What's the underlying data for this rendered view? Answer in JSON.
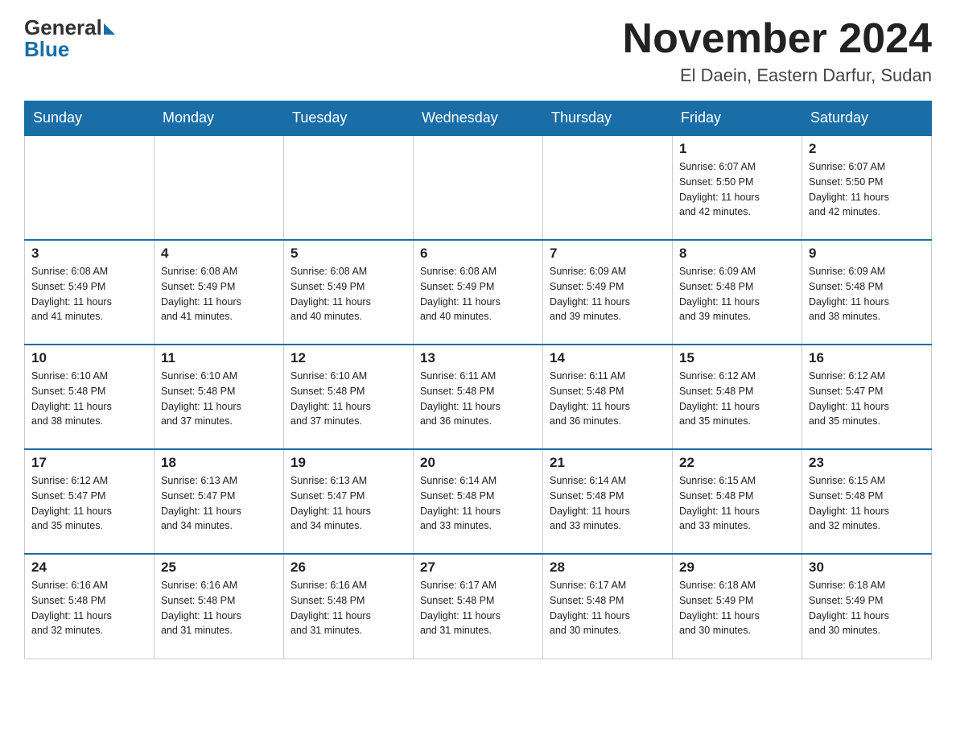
{
  "logo": {
    "general": "General",
    "blue": "Blue"
  },
  "title": "November 2024",
  "subtitle": "El Daein, Eastern Darfur, Sudan",
  "weekdays": [
    "Sunday",
    "Monday",
    "Tuesday",
    "Wednesday",
    "Thursday",
    "Friday",
    "Saturday"
  ],
  "weeks": [
    [
      {
        "day": "",
        "info": ""
      },
      {
        "day": "",
        "info": ""
      },
      {
        "day": "",
        "info": ""
      },
      {
        "day": "",
        "info": ""
      },
      {
        "day": "",
        "info": ""
      },
      {
        "day": "1",
        "info": "Sunrise: 6:07 AM\nSunset: 5:50 PM\nDaylight: 11 hours\nand 42 minutes."
      },
      {
        "day": "2",
        "info": "Sunrise: 6:07 AM\nSunset: 5:50 PM\nDaylight: 11 hours\nand 42 minutes."
      }
    ],
    [
      {
        "day": "3",
        "info": "Sunrise: 6:08 AM\nSunset: 5:49 PM\nDaylight: 11 hours\nand 41 minutes."
      },
      {
        "day": "4",
        "info": "Sunrise: 6:08 AM\nSunset: 5:49 PM\nDaylight: 11 hours\nand 41 minutes."
      },
      {
        "day": "5",
        "info": "Sunrise: 6:08 AM\nSunset: 5:49 PM\nDaylight: 11 hours\nand 40 minutes."
      },
      {
        "day": "6",
        "info": "Sunrise: 6:08 AM\nSunset: 5:49 PM\nDaylight: 11 hours\nand 40 minutes."
      },
      {
        "day": "7",
        "info": "Sunrise: 6:09 AM\nSunset: 5:49 PM\nDaylight: 11 hours\nand 39 minutes."
      },
      {
        "day": "8",
        "info": "Sunrise: 6:09 AM\nSunset: 5:48 PM\nDaylight: 11 hours\nand 39 minutes."
      },
      {
        "day": "9",
        "info": "Sunrise: 6:09 AM\nSunset: 5:48 PM\nDaylight: 11 hours\nand 38 minutes."
      }
    ],
    [
      {
        "day": "10",
        "info": "Sunrise: 6:10 AM\nSunset: 5:48 PM\nDaylight: 11 hours\nand 38 minutes."
      },
      {
        "day": "11",
        "info": "Sunrise: 6:10 AM\nSunset: 5:48 PM\nDaylight: 11 hours\nand 37 minutes."
      },
      {
        "day": "12",
        "info": "Sunrise: 6:10 AM\nSunset: 5:48 PM\nDaylight: 11 hours\nand 37 minutes."
      },
      {
        "day": "13",
        "info": "Sunrise: 6:11 AM\nSunset: 5:48 PM\nDaylight: 11 hours\nand 36 minutes."
      },
      {
        "day": "14",
        "info": "Sunrise: 6:11 AM\nSunset: 5:48 PM\nDaylight: 11 hours\nand 36 minutes."
      },
      {
        "day": "15",
        "info": "Sunrise: 6:12 AM\nSunset: 5:48 PM\nDaylight: 11 hours\nand 35 minutes."
      },
      {
        "day": "16",
        "info": "Sunrise: 6:12 AM\nSunset: 5:47 PM\nDaylight: 11 hours\nand 35 minutes."
      }
    ],
    [
      {
        "day": "17",
        "info": "Sunrise: 6:12 AM\nSunset: 5:47 PM\nDaylight: 11 hours\nand 35 minutes."
      },
      {
        "day": "18",
        "info": "Sunrise: 6:13 AM\nSunset: 5:47 PM\nDaylight: 11 hours\nand 34 minutes."
      },
      {
        "day": "19",
        "info": "Sunrise: 6:13 AM\nSunset: 5:47 PM\nDaylight: 11 hours\nand 34 minutes."
      },
      {
        "day": "20",
        "info": "Sunrise: 6:14 AM\nSunset: 5:48 PM\nDaylight: 11 hours\nand 33 minutes."
      },
      {
        "day": "21",
        "info": "Sunrise: 6:14 AM\nSunset: 5:48 PM\nDaylight: 11 hours\nand 33 minutes."
      },
      {
        "day": "22",
        "info": "Sunrise: 6:15 AM\nSunset: 5:48 PM\nDaylight: 11 hours\nand 33 minutes."
      },
      {
        "day": "23",
        "info": "Sunrise: 6:15 AM\nSunset: 5:48 PM\nDaylight: 11 hours\nand 32 minutes."
      }
    ],
    [
      {
        "day": "24",
        "info": "Sunrise: 6:16 AM\nSunset: 5:48 PM\nDaylight: 11 hours\nand 32 minutes."
      },
      {
        "day": "25",
        "info": "Sunrise: 6:16 AM\nSunset: 5:48 PM\nDaylight: 11 hours\nand 31 minutes."
      },
      {
        "day": "26",
        "info": "Sunrise: 6:16 AM\nSunset: 5:48 PM\nDaylight: 11 hours\nand 31 minutes."
      },
      {
        "day": "27",
        "info": "Sunrise: 6:17 AM\nSunset: 5:48 PM\nDaylight: 11 hours\nand 31 minutes."
      },
      {
        "day": "28",
        "info": "Sunrise: 6:17 AM\nSunset: 5:48 PM\nDaylight: 11 hours\nand 30 minutes."
      },
      {
        "day": "29",
        "info": "Sunrise: 6:18 AM\nSunset: 5:49 PM\nDaylight: 11 hours\nand 30 minutes."
      },
      {
        "day": "30",
        "info": "Sunrise: 6:18 AM\nSunset: 5:49 PM\nDaylight: 11 hours\nand 30 minutes."
      }
    ]
  ]
}
